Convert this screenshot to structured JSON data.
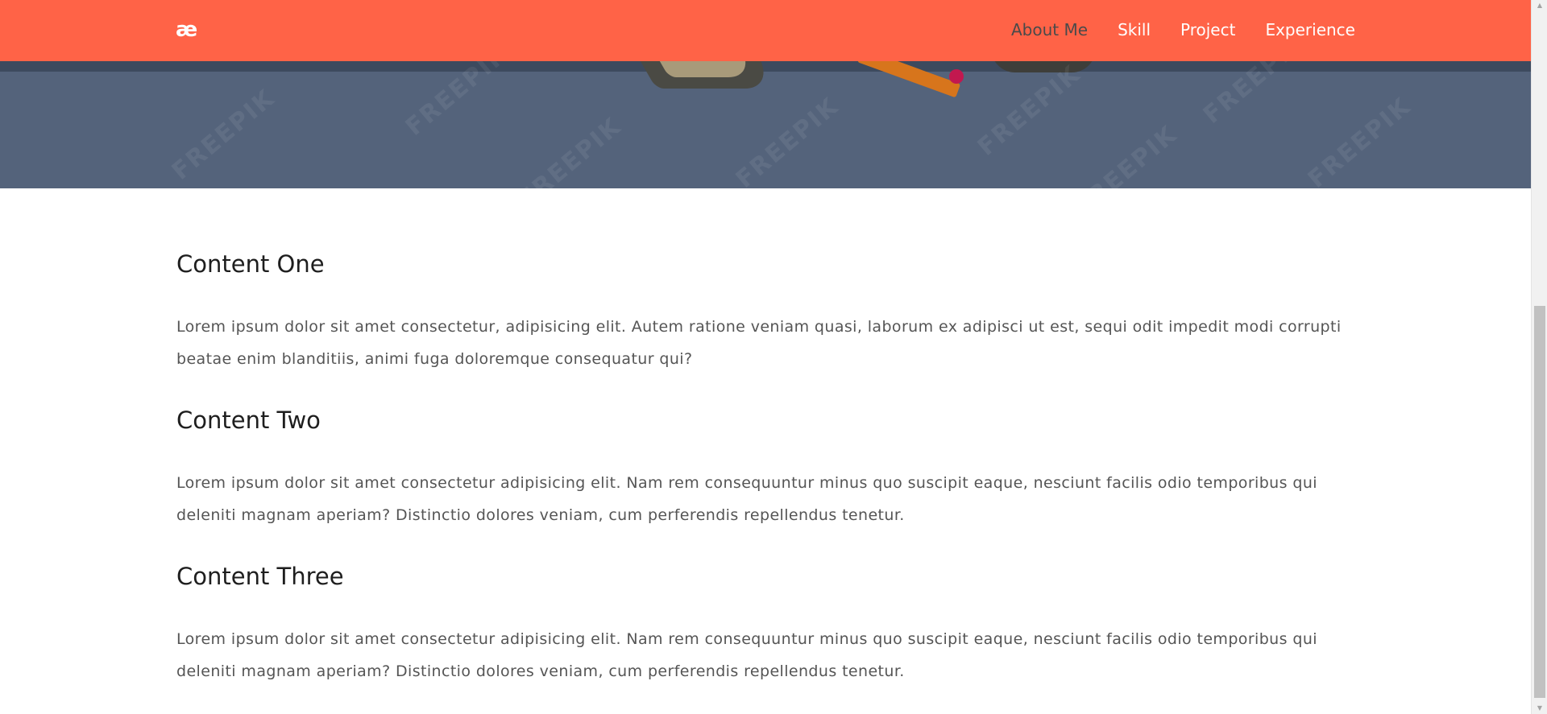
{
  "navbar": {
    "logo": "æ",
    "links": [
      {
        "label": "About Me",
        "active": true
      },
      {
        "label": "Skill",
        "active": false
      },
      {
        "label": "Project",
        "active": false
      },
      {
        "label": "Experience",
        "active": false
      }
    ]
  },
  "hero": {
    "watermark": "FREEPIK"
  },
  "sections": [
    {
      "title": "Content One",
      "body": "Lorem ipsum dolor sit amet consectetur, adipisicing elit. Autem ratione veniam quasi, laborum ex adipisci ut est, sequi odit impedit modi corrupti beatae enim blanditiis, animi fuga doloremque consequatur qui?"
    },
    {
      "title": "Content Two",
      "body": "Lorem ipsum dolor sit amet consectetur adipisicing elit. Nam rem consequuntur minus quo suscipit eaque, nesciunt facilis odio temporibus qui deleniti magnam aperiam? Distinctio dolores veniam, cum perferendis repellendus tenetur."
    },
    {
      "title": "Content Three",
      "body": "Lorem ipsum dolor sit amet consectetur adipisicing elit. Nam rem consequuntur minus quo suscipit eaque, nesciunt facilis odio temporibus qui deleniti magnam aperiam? Distinctio dolores veniam, cum perferendis repellendus tenetur."
    }
  ],
  "colors": {
    "navbar_bg": "#ff6347",
    "hero_bg": "#54637b",
    "nav_active": "#4a4a4a",
    "heading": "#1e1e1e",
    "body_text": "#555555"
  },
  "scrollbar": {
    "scroll_position": 0.85
  }
}
